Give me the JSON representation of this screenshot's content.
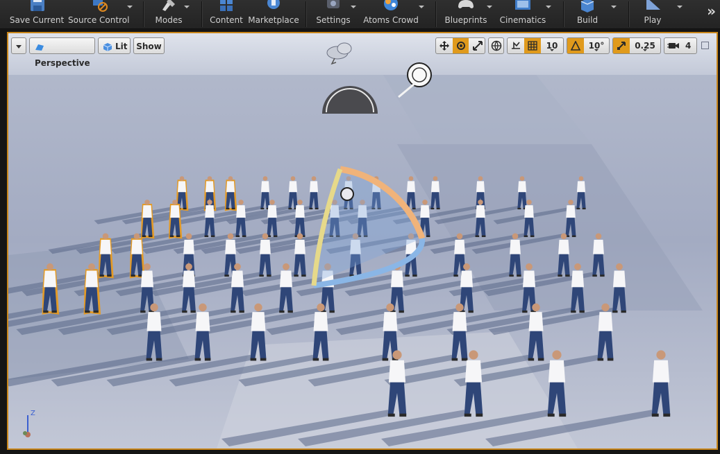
{
  "toolbar": {
    "items": [
      {
        "label": "Save Current",
        "icon": "save-icon"
      },
      {
        "label": "Source Control",
        "icon": "source-control-icon"
      },
      {
        "label": "Modes",
        "icon": "modes-icon"
      },
      {
        "label": "Content",
        "icon": "content-icon"
      },
      {
        "label": "Marketplace",
        "icon": "marketplace-icon"
      },
      {
        "label": "Settings",
        "icon": "settings-icon"
      },
      {
        "label": "Atoms Crowd",
        "icon": "atoms-crowd-icon"
      },
      {
        "label": "Blueprints",
        "icon": "blueprints-icon"
      },
      {
        "label": "Cinematics",
        "icon": "cinematics-icon"
      },
      {
        "label": "Build",
        "icon": "build-icon"
      },
      {
        "label": "Play",
        "icon": "play-icon"
      }
    ],
    "more_icon": "chevron-double-right-icon"
  },
  "viewport": {
    "view_mode": "Perspective",
    "lighting_mode": "Lit",
    "show_label": "Show",
    "grid_snap": "10",
    "rotation_snap": "10°",
    "scale_snap": "0.25",
    "camera_speed": "4",
    "axis_label": "Z",
    "accent": "#e09a1c",
    "selection_outline": "#e39a26"
  }
}
